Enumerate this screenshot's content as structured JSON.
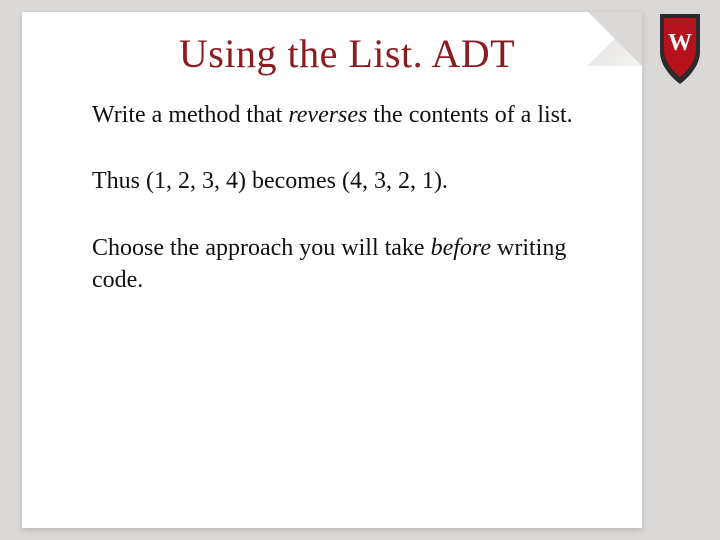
{
  "slide": {
    "title": "Using the List. ADT",
    "p1_pre": "Write a method that ",
    "p1_em": "reverses",
    "p1_post": " the contents of a list.",
    "p2": "Thus  (1, 2, 3, 4)  becomes  (4, 3, 2, 1).",
    "p3_pre": "Choose the approach you will take ",
    "p3_em": "before",
    "p3_post": " writing code."
  },
  "crest_letter": "W",
  "colors": {
    "title": "#8a1d22",
    "card_bg": "#ffffff",
    "page_bg": "#dad9d7",
    "crest_red": "#b5121b",
    "crest_dark": "#2b2b2b"
  }
}
